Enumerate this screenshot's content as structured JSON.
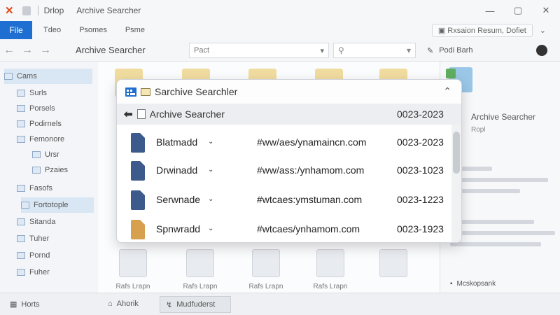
{
  "titlebar": {
    "title1": "Drlop",
    "title2": "Archive Searcher"
  },
  "ribbon": {
    "file_tab": "File",
    "tabs": [
      "Tdeo",
      "Psomes",
      "Psme"
    ],
    "right_label": "Rxsaion Resum, Dofiet"
  },
  "address": {
    "title": "Archive Searcher",
    "path_value": "Pact",
    "search_placeholder": "",
    "right_label": "Podi Barh"
  },
  "navpane": {
    "items": [
      {
        "label": "Cams"
      },
      {
        "label": "Surls"
      },
      {
        "label": "Porsels"
      },
      {
        "label": "Podirnels"
      },
      {
        "label": "Femonore"
      },
      {
        "label": "Ursr"
      },
      {
        "label": "Pzaies"
      },
      {
        "label": "Fasofs"
      },
      {
        "label": "Fortotople"
      },
      {
        "label": "Sitanda"
      },
      {
        "label": "Tuher"
      },
      {
        "label": "Pornd"
      },
      {
        "label": "Fuher"
      }
    ]
  },
  "content": {
    "labels": [
      "Rafs Lrapn",
      "Rafs Lrapn",
      "Rafs Lrapn",
      "Rafs Lrapn"
    ]
  },
  "preview": {
    "title": "Archive Searcher",
    "subtitle": "Ropl",
    "link": "Mcskopsank"
  },
  "statusbar": {
    "left": "Horts",
    "mid": "Ahorik",
    "tab": "Mudfuderst"
  },
  "popup": {
    "title": "Sarchive Searchler",
    "bar_title": "Archive Searcher",
    "bar_date": "0023-2023",
    "rows": [
      {
        "name": "Blatmadd",
        "url": "#ww/aes/ynamaincn.com",
        "date": "0023-2023",
        "icon_color": "blue"
      },
      {
        "name": "Drwinadd",
        "url": "#ww/ass:/ynhamom.com",
        "date": "0023-1023",
        "icon_color": "blue"
      },
      {
        "name": "Serwnade",
        "url": "#wtcaes:ymstuman.com",
        "date": "0023-1223",
        "icon_color": "blue"
      },
      {
        "name": "Spnwradd",
        "url": "#wtcaes/ynhamom.com",
        "date": "0023-1923",
        "icon_color": "orange"
      }
    ]
  }
}
